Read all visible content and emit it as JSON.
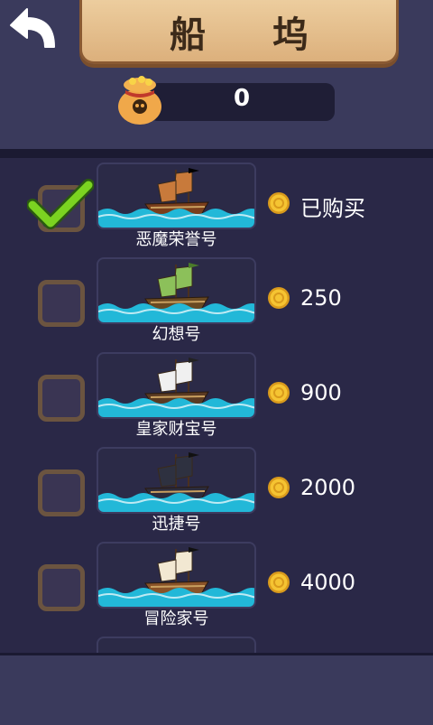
{
  "header": {
    "title": "船 坞",
    "coins": "0"
  },
  "ships": [
    {
      "name": "恶魔荣誉号",
      "price": "已购买",
      "selected": true,
      "sail": "#c87a3b",
      "hull": "#7a3e1c",
      "flag": "#000000"
    },
    {
      "name": "幻想号",
      "price": "250",
      "selected": false,
      "sail": "#8cc05a",
      "hull": "#6a4a22",
      "flag": "#4b7b2a"
    },
    {
      "name": "皇家财宝号",
      "price": "900",
      "selected": false,
      "sail": "#f0f0f0",
      "hull": "#5a3a22",
      "flag": "#222222"
    },
    {
      "name": "迅捷号",
      "price": "2000",
      "selected": false,
      "sail": "#2e3140",
      "hull": "#2c2c3c",
      "flag": "#111111"
    },
    {
      "name": "冒险家号",
      "price": "4000",
      "selected": false,
      "sail": "#f2e8d2",
      "hull": "#8a5328",
      "flag": "#111111"
    }
  ],
  "colors": {
    "water": "#22b8d8",
    "coin": "#f5c432",
    "check": "#7bd321"
  }
}
